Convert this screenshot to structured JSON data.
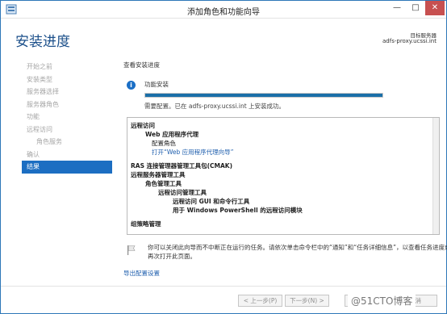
{
  "window": {
    "title": "添加角色和功能向导",
    "minimize": "—",
    "maximize": "□",
    "close": "✕"
  },
  "header": {
    "title": "安装进度",
    "target_label": "目标服务器",
    "target_host": "adfs-proxy.ucssi.int"
  },
  "sidebar": {
    "items": [
      {
        "label": "开始之前"
      },
      {
        "label": "安装类型"
      },
      {
        "label": "服务器选择"
      },
      {
        "label": "服务器角色"
      },
      {
        "label": "功能"
      },
      {
        "label": "远程访问"
      },
      {
        "label": "角色服务"
      },
      {
        "label": "确认"
      },
      {
        "label": "结果"
      }
    ]
  },
  "main": {
    "section_title": "查看安装进度",
    "status_label": "功能安装",
    "progress_percent": 100,
    "result_text": "需要配置。已在 adfs-proxy.ucssi.int 上安装成功。",
    "results": [
      "远程访问",
      "Web 应用程序代理",
      "配置角色",
      "打开“Web 应用程序代理向导”",
      "RAS 连接管理器管理工具包(CMAK)",
      "远程服务器管理工具",
      "角色管理工具",
      "远程访问管理工具",
      "远程访问 GUI 和命令行工具",
      "用于 Windows PowerShell 的远程访问模块",
      "组策略管理"
    ],
    "note": "你可以关闭此向导而不中断正在运行的任务。请依次单击命令栏中的“通知”和“任务详细信息”，以查看任务进度或再次打开此页面。",
    "export_link": "导出配置设置"
  },
  "footer": {
    "prev": "< 上一步(P)",
    "next": "下一步(N) >",
    "close": "关闭",
    "cancel": "取消",
    "watermark": "@51CTO博客"
  },
  "colors": {
    "accent": "#1c6ec2",
    "progress": "#1b6fa8",
    "link": "#1f5fae"
  }
}
